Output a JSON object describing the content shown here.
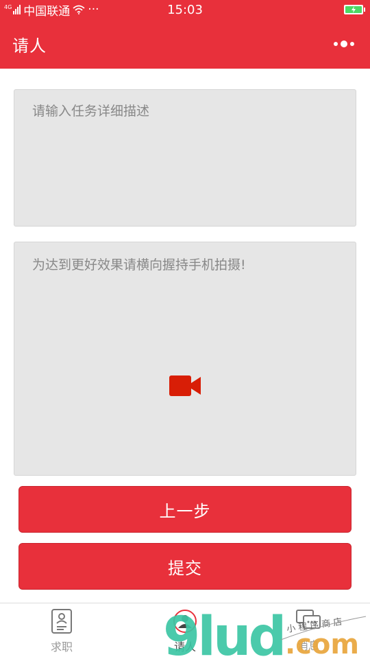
{
  "status_bar": {
    "network": "4G",
    "carrier": "中国联通",
    "extra": "···",
    "time": "15:03"
  },
  "nav": {
    "title": "请人",
    "more_icon": "more-dots-icon"
  },
  "task": {
    "placeholder": "请输入任务详细描述",
    "value": ""
  },
  "video": {
    "hint": "为达到更好效果请横向握持手机拍摄!",
    "icon": "video-camera-icon",
    "icon_color": "#d81e06"
  },
  "buttons": {
    "prev": "上一步",
    "submit": "提交"
  },
  "tabs": [
    {
      "label": "求职",
      "icon": "resume-icon",
      "active": false
    },
    {
      "label": "请人",
      "icon": "person-icon",
      "active": true
    },
    {
      "label": "消息",
      "icon": "chat-icon",
      "active": false
    }
  ],
  "watermark": {
    "text_primary": "9lud",
    "text_domain": ".com",
    "text_small": "小 程 序 商 店"
  },
  "colors": {
    "brand": "#e8303b",
    "input_bg": "#e6e6e6",
    "placeholder": "#888888"
  }
}
